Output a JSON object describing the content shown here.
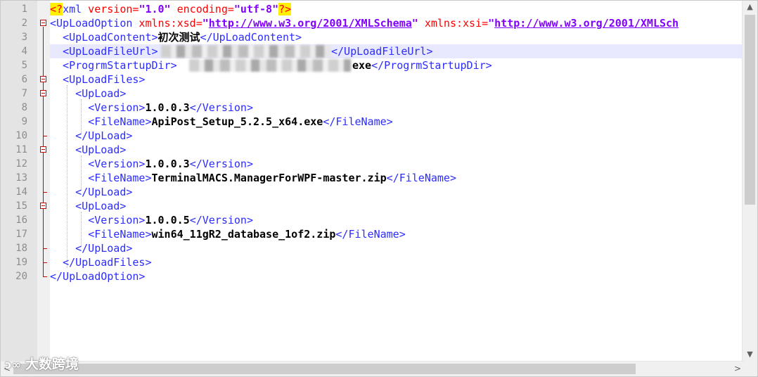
{
  "line_numbers": [
    "1",
    "2",
    "3",
    "4",
    "5",
    "6",
    "7",
    "8",
    "9",
    "10",
    "11",
    "12",
    "13",
    "14",
    "15",
    "16",
    "17",
    "18",
    "19",
    "20"
  ],
  "colors": {
    "tag": "#2c2cff",
    "attr": "#ff0000",
    "value": "#8000ff",
    "text": "#000000",
    "current_line": "#e8e8ff",
    "pi_highlight": "#ffef00"
  },
  "code": {
    "l1": {
      "pi_open": "<?",
      "xml": "xml",
      "attr1": " version=",
      "val1": "\"1.0\"",
      "attr2": " encoding=",
      "val2": "\"utf-8\"",
      "pi_close": "?>"
    },
    "l2": {
      "tag": "<UpLoadOption",
      "attr1": " xmlns:xsd=",
      "q1": "\"",
      "url1": "http://www.w3.org/2001/XMLSchema",
      "q2": "\"",
      "attr2": " xmlns:xsi=",
      "q3": "\"",
      "url2": "http://www.w3.org/2001/XMLSch"
    },
    "l3": {
      "open": "<UpLoadContent>",
      "text": "初次测试",
      "close": "</UpLoadContent>"
    },
    "l4": {
      "open": "<UpLoadFileUrl>",
      "close": "</UpLoadFileUrl>"
    },
    "l5": {
      "open": "<ProgrmStartupDir>",
      "text_end": "exe",
      "close": "</ProgrmStartupDir>"
    },
    "l6": {
      "open": "<UpLoadFiles>"
    },
    "upload_open": "<UpLoad>",
    "upload_close": "</UpLoad>",
    "version_open": "<Version>",
    "version_close": "</Version>",
    "filename_open": "<FileName>",
    "filename_close": "</FileName>",
    "files": [
      {
        "version": "1.0.0.3",
        "filename": "ApiPost_Setup_5.2.5_x64.exe"
      },
      {
        "version": "1.0.0.3",
        "filename": "TerminalMACS.ManagerForWPF-master.zip"
      },
      {
        "version": "1.0.0.5",
        "filename": "win64_11gR2_database_1of2.zip"
      }
    ],
    "l19": {
      "close": "</UpLoadFiles>"
    },
    "l20": {
      "close": "</UpLoadOption>"
    }
  },
  "scrollbar": {
    "up": "▲",
    "down": "▼",
    "left": "<",
    "right": ">"
  },
  "watermark": {
    "logo": "ↄ∞",
    "text": "大数跨境"
  }
}
